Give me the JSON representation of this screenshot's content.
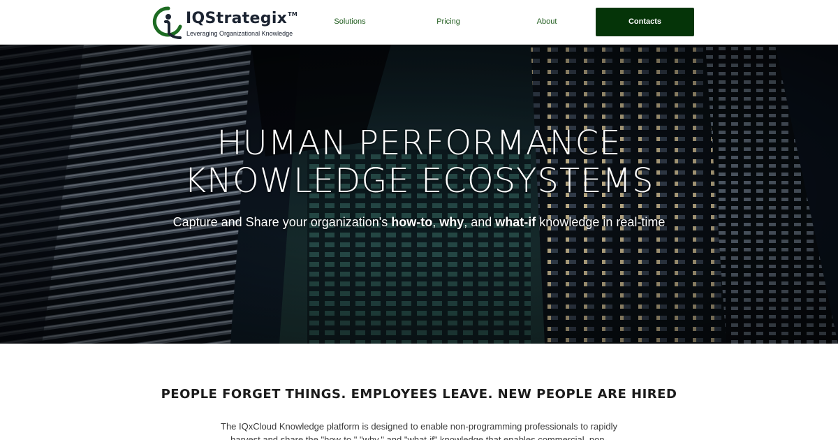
{
  "header": {
    "logo": {
      "wordmark": "IQStrategix",
      "trademark": "TM",
      "tagline": "Leveraging Organizational Knowledge"
    },
    "nav": [
      {
        "label": "Solutions"
      },
      {
        "label": "Pricing"
      },
      {
        "label": "About"
      }
    ],
    "cta_label": "Contacts"
  },
  "hero": {
    "title_line1": "Human Performance",
    "title_line2": "Knowledge Ecosystems",
    "subtitle": {
      "part1": "Capture and Share your organization's ",
      "b1": "how-to",
      "sep1": ", ",
      "b2": "why",
      "sep2": ", and ",
      "b3": "what-if",
      "part2": " knowledge in real-time"
    }
  },
  "intro": {
    "heading": "People forget things. Employees leave. New people are hired",
    "body": "The IQxCloud Knowledge platform is designed to enable non-programming professionals to rapidly harvest and share the \"how-to,\" \"why,\" and \"what-if\" knowledge that enables commercial, non-"
  },
  "colors": {
    "brand_green": "#053408",
    "nav_link": "#1f5c1d",
    "logo_blue": "#1b2331"
  }
}
